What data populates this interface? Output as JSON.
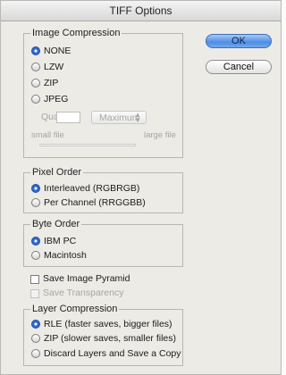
{
  "window": {
    "title": "TIFF Options"
  },
  "buttons": {
    "ok": "OK",
    "cancel": "Cancel"
  },
  "image_compression": {
    "legend": "Image Compression",
    "options": [
      "NONE",
      "LZW",
      "ZIP",
      "JPEG"
    ],
    "selected": "NONE",
    "quality_label": "Quality:",
    "quality_value": "",
    "quality_preset": "Maximum",
    "small_file": "small file",
    "large_file": "large file"
  },
  "pixel_order": {
    "legend": "Pixel Order",
    "options": [
      "Interleaved (RGBRGB)",
      "Per Channel (RRGGBB)"
    ],
    "selected": "Interleaved (RGBRGB)"
  },
  "byte_order": {
    "legend": "Byte Order",
    "options": [
      "IBM PC",
      "Macintosh"
    ],
    "selected": "IBM PC"
  },
  "checkboxes": {
    "save_image_pyramid": "Save Image Pyramid",
    "save_transparency": "Save Transparency"
  },
  "layer_compression": {
    "legend": "Layer Compression",
    "options": [
      "RLE (faster saves, bigger files)",
      "ZIP (slower saves, smaller files)",
      "Discard Layers and Save a Copy"
    ],
    "selected": "RLE (faster saves, bigger files)"
  },
  "colors": {
    "accent": "#2d6ad6",
    "ok_button": "#4f8ce4"
  }
}
